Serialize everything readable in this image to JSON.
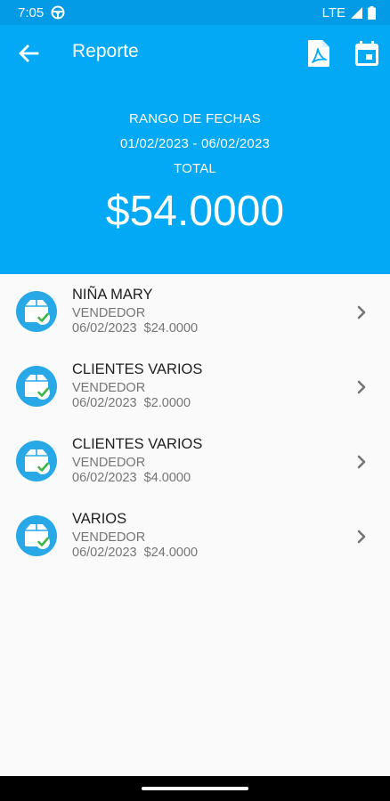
{
  "status_bar": {
    "time": "7:05",
    "network": "LTE"
  },
  "app_bar": {
    "title": "Reporte",
    "back_icon": "arrow-back-icon",
    "pdf_icon": "pdf-file-icon",
    "calendar_icon": "calendar-icon"
  },
  "summary": {
    "range_label": "RANGO DE FECHAS",
    "range_value": "01/02/2023 - 06/02/2023",
    "total_label": "TOTAL",
    "total_value": "$54.0000"
  },
  "sales": [
    {
      "customer": "NIÑA MARY",
      "role": "VENDEDOR",
      "date": "06/02/2023",
      "amount": "$24.0000"
    },
    {
      "customer": "CLIENTES VARIOS",
      "role": "VENDEDOR",
      "date": "06/02/2023",
      "amount": "$2.0000"
    },
    {
      "customer": "CLIENTES VARIOS",
      "role": "VENDEDOR",
      "date": "06/02/2023",
      "amount": "$4.0000"
    },
    {
      "customer": "VARIOS",
      "role": "VENDEDOR",
      "date": "06/02/2023",
      "amount": "$24.0000"
    }
  ],
  "colors": {
    "status_bar": "#039be5",
    "header": "#03a9f4",
    "avatar": "#29a8e8",
    "check": "#3fb549",
    "background": "#fafafa"
  }
}
